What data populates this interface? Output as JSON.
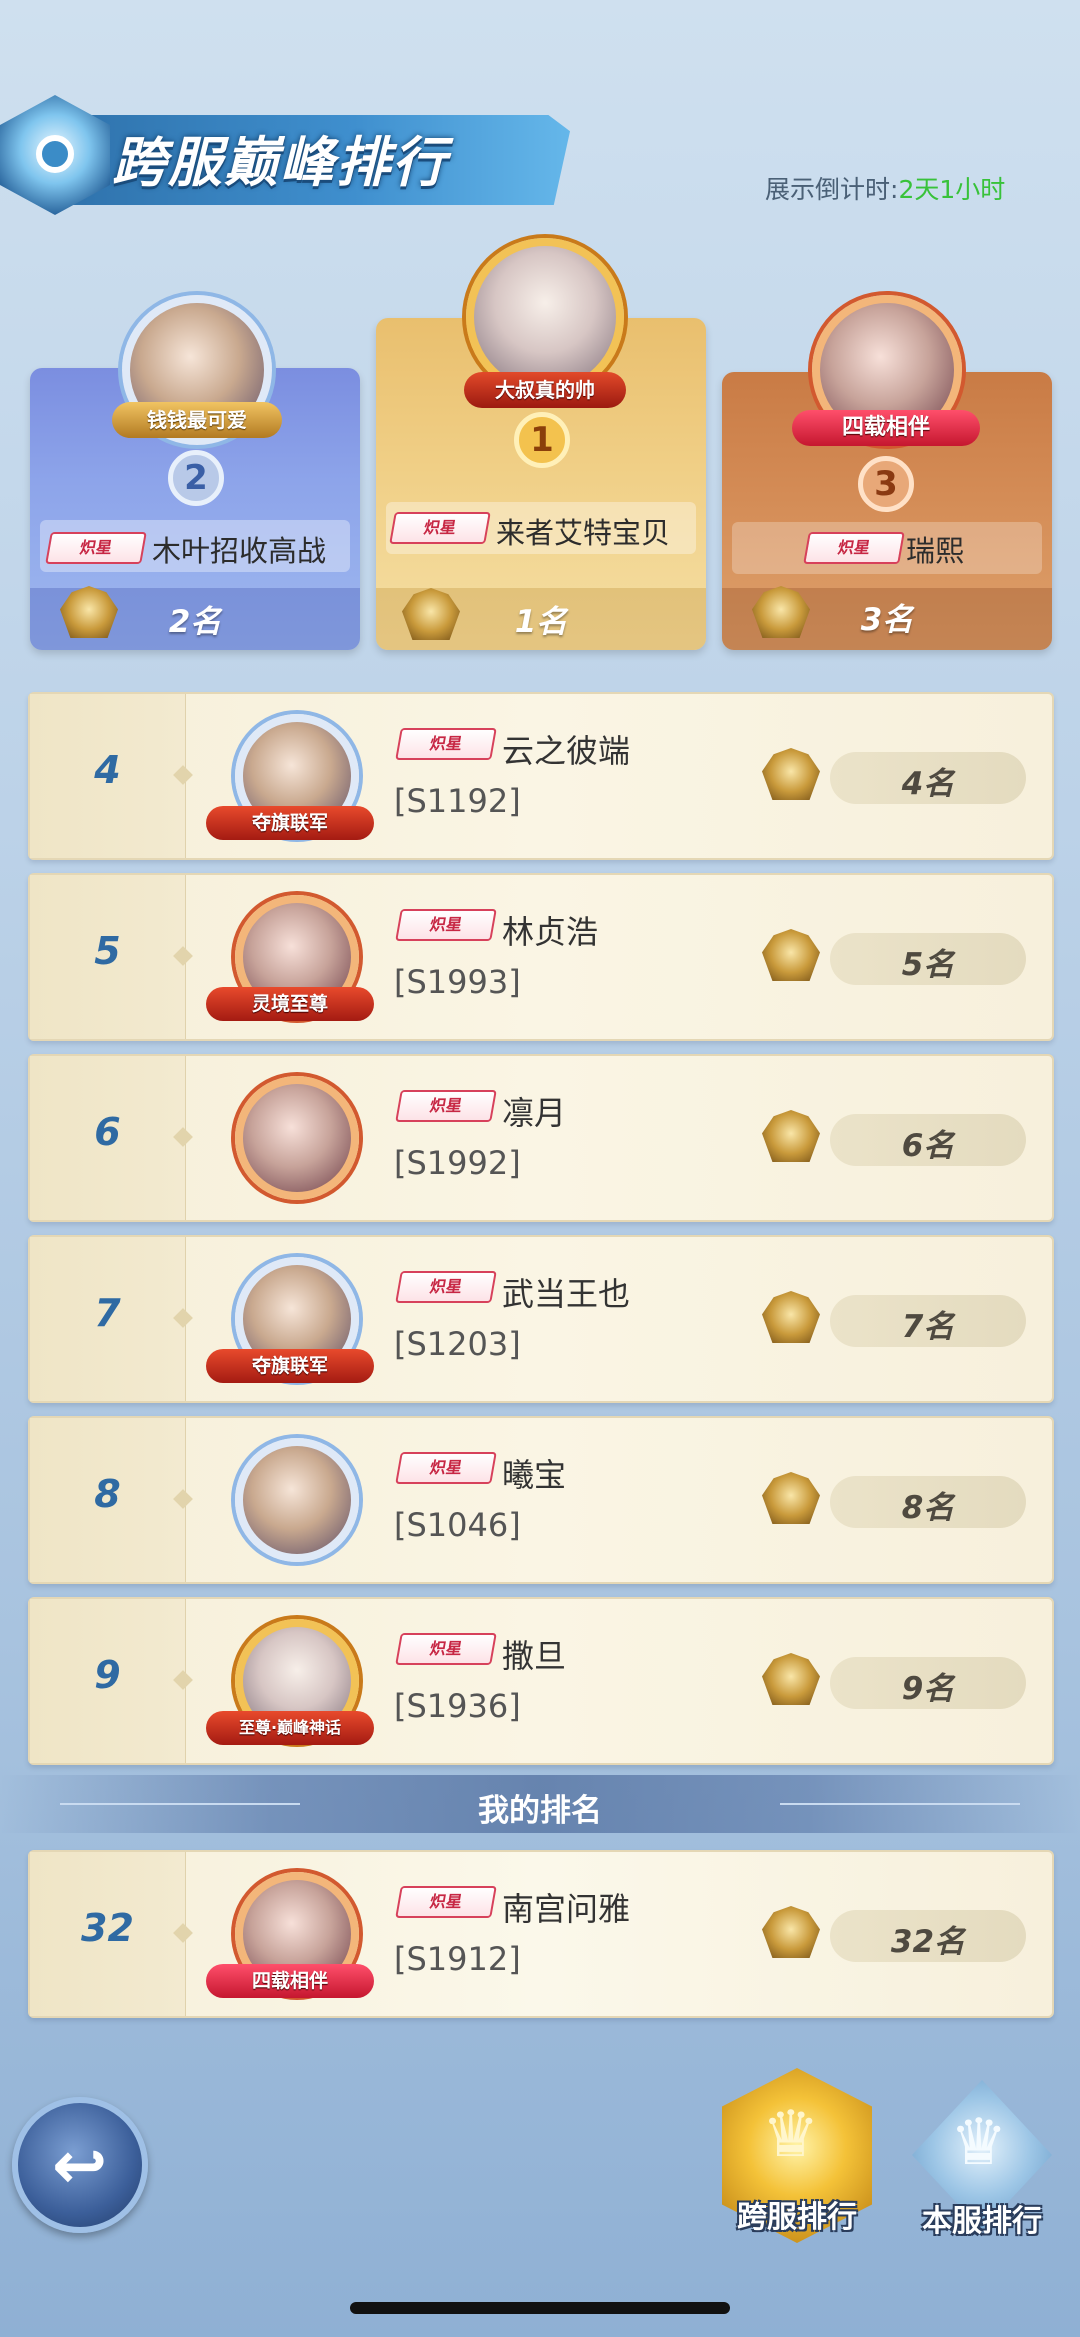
{
  "header": {
    "title": "跨服巅峰排行",
    "countdown_label": "展示倒计时:",
    "countdown_value": "2天1小时"
  },
  "podium": [
    {
      "position": 2,
      "title": "钱钱最可爱",
      "badge": "炽星",
      "name": "木叶招收高战",
      "rank_text": "2名"
    },
    {
      "position": 1,
      "title": "大叔真的帅",
      "badge": "炽星",
      "name": "来者艾特宝贝",
      "rank_text": "1名"
    },
    {
      "position": 3,
      "title": "四载相伴",
      "badge": "炽星",
      "name": "瑞熙",
      "rank_text": "3名"
    }
  ],
  "rows": [
    {
      "rank": "4",
      "plate": "夺旗联军",
      "badge": "炽星",
      "name": "云之彼端",
      "server": "[S1192]",
      "rank_text": "4名"
    },
    {
      "rank": "5",
      "plate": "灵境至尊",
      "badge": "炽星",
      "name": "林贞浩",
      "server": "[S1993]",
      "rank_text": "5名"
    },
    {
      "rank": "6",
      "plate": "",
      "badge": "炽星",
      "name": "凛月",
      "server": "[S1992]",
      "rank_text": "6名"
    },
    {
      "rank": "7",
      "plate": "夺旗联军",
      "badge": "炽星",
      "name": "武当王也",
      "server": "[S1203]",
      "rank_text": "7名"
    },
    {
      "rank": "8",
      "plate": "",
      "badge": "炽星",
      "name": "曦宝",
      "server": "[S1046]",
      "rank_text": "8名"
    },
    {
      "rank": "9",
      "plate": "至尊·巅峰神话",
      "badge": "炽星",
      "name": "撒旦",
      "server": "[S1936]",
      "rank_text": "9名"
    }
  ],
  "my_rank": {
    "section_title": "我的排名",
    "rank": "32",
    "plate": "四载相伴",
    "badge": "炽星",
    "name": "南宫问雅",
    "server": "[S1912]",
    "rank_text": "32名"
  },
  "tabs": {
    "cross_server": "跨服排行",
    "local_server": "本服排行"
  },
  "icons": {
    "back": "back-arrow-icon",
    "crown": "crown-icon"
  },
  "colors": {
    "accent_blue": "#2f6aa3",
    "countdown_green": "#38c23a",
    "badge_red": "#c72744"
  }
}
